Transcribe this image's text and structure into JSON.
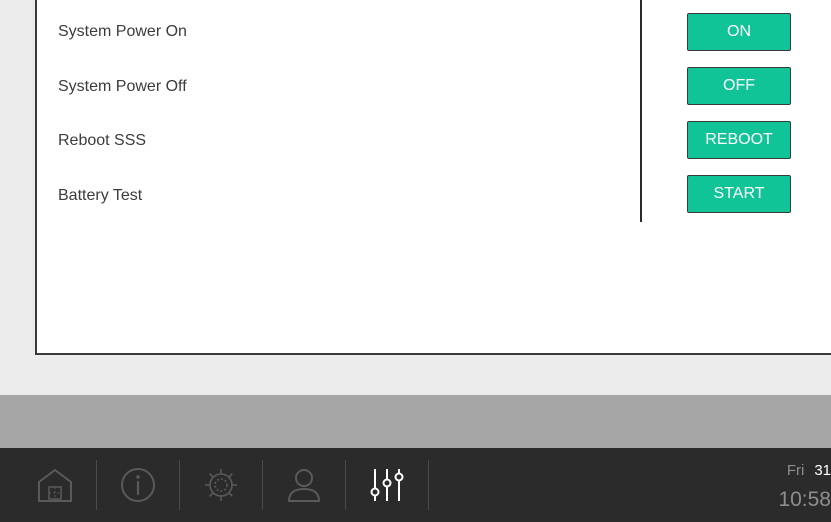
{
  "controls": {
    "rows": [
      {
        "label": "System Power On",
        "button": "ON"
      },
      {
        "label": "System Power Off",
        "button": "OFF"
      },
      {
        "label": "Reboot SSS",
        "button": "REBOOT"
      },
      {
        "label": "Battery Test",
        "button": "START"
      }
    ]
  },
  "taskbar": {
    "items": [
      {
        "icon": "home-icon",
        "active": false
      },
      {
        "icon": "info-icon",
        "active": false
      },
      {
        "icon": "gear-icon",
        "active": false
      },
      {
        "icon": "user-icon",
        "active": false
      },
      {
        "icon": "sliders-icon",
        "active": true
      }
    ],
    "day_name": "Fri",
    "day_number": "31",
    "time": "10:58"
  },
  "colors": {
    "button": "#10c497",
    "taskbar": "#2b2b2b",
    "icon_inactive": "#5a5a5a",
    "icon_active": "#ffffff"
  }
}
